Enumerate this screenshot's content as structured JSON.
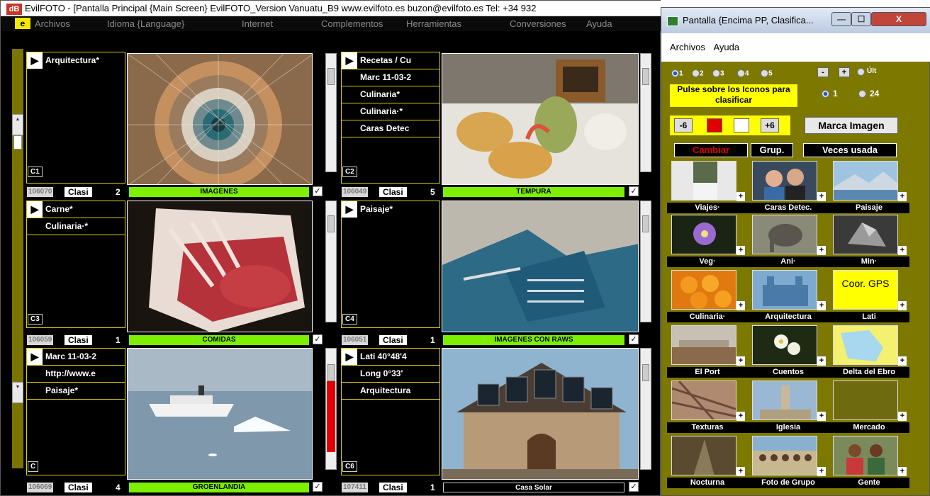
{
  "main": {
    "title": "EvilFOTO - [Pantalla Principal  {Main Screen} EvilFOTO_Version Vanuatu_B9   www.evilfoto.es   buzon@evilfoto.es   Tel: +34 932",
    "app_icon": "dB",
    "menu_icon": "e",
    "menu": [
      "Archivos",
      "Idioma {Language}",
      "Internet",
      "Complementos",
      "Herramientas",
      "Conversiones",
      "Ayuda"
    ]
  },
  "cells": [
    {
      "code": "C1",
      "tags": [
        "Arquitectura*"
      ],
      "id": "106070",
      "clasi": "Clasi",
      "count": "2",
      "group": "IMAGENES",
      "check": "✓",
      "photo_icon": "spiral-staircase-icon"
    },
    {
      "code": "C2",
      "tags": [
        "Recetas / Cu",
        "Marc 11-03-2",
        "Culinaria*",
        "Culinaria·*",
        "Caras Detec"
      ],
      "id": "106049",
      "clasi": "Clasi",
      "count": "5",
      "group": "TEMPURA",
      "check": "✓",
      "photo_icon": "tempura-food-icon"
    },
    {
      "code": "C3",
      "tags": [
        "Carne*",
        "Culinaria·*"
      ],
      "id": "106059",
      "clasi": "Clasi",
      "count": "1",
      "group": "COMIDAS",
      "check": "✓",
      "photo_icon": "raw-meat-icon"
    },
    {
      "code": "C4",
      "tags": [
        "Paisaje*"
      ],
      "id": "106051",
      "clasi": "Clasi",
      "count": "1",
      "group": "IMAGENES CON RAWS",
      "check": "✓",
      "photo_icon": "harbor-aerial-icon"
    },
    {
      "code": "C",
      "tags": [
        "Marc 11-03-2",
        "http://www.e",
        "Paisaje*"
      ],
      "id": "106069",
      "clasi": "Clasi",
      "count": "4",
      "group": "GROENLANDIA",
      "check": "✓",
      "photo_icon": "cruise-ship-icon"
    },
    {
      "code": "C6",
      "tags": [
        "Lati  40°48'4",
        "Long   0°33'",
        "Arquitectura"
      ],
      "id": "107411",
      "clasi": "Clasi",
      "count": "1",
      "group": "Casa Solar",
      "check": "✓",
      "photo_icon": "solar-house-icon"
    }
  ],
  "right": {
    "title": "Pantalla {Encima PP, Clasifica...",
    "window_buttons": [
      "—",
      "☐",
      "X"
    ],
    "menu": [
      "Archivos",
      "Ayuda"
    ],
    "radios": [
      "1",
      "2",
      "3",
      "4",
      "5"
    ],
    "minus": "-",
    "plus": "+",
    "ult": "Últ",
    "note": "Pulse sobre los Iconos para clasificar",
    "radio_1": "1",
    "radio_24": "24",
    "minus6": "-6",
    "plus6": "+6",
    "marca": "Marca Imagen",
    "cambiar": "Cambiar",
    "grup": "Grup.",
    "veces": "Veces usada",
    "gps_text": "Coor. GPS",
    "icons": [
      {
        "label": "Viajes·",
        "icon": "snow-wall-icon"
      },
      {
        "label": "Caras Detec.",
        "icon": "couple-portrait-icon"
      },
      {
        "label": "Paisaje",
        "icon": "mountain-lake-icon"
      },
      {
        "label": "Veg·",
        "icon": "purple-flower-icon"
      },
      {
        "label": "Ani·",
        "icon": "elephant-icon"
      },
      {
        "label": "Min·",
        "icon": "mineral-icon"
      },
      {
        "label": "Culinaria·",
        "icon": "oranges-icon"
      },
      {
        "label": "Arquitectura",
        "icon": "castle-icon"
      },
      {
        "label": "Lati",
        "icon": "gps-coordinates-icon"
      },
      {
        "label": "El Port",
        "icon": "port-icon"
      },
      {
        "label": "Cuentos",
        "icon": "white-flowers-icon"
      },
      {
        "label": "Delta del Ebro",
        "icon": "map-icon"
      },
      {
        "label": "Texturas",
        "icon": "texture-icon"
      },
      {
        "label": "Iglesia",
        "icon": "church-tower-icon"
      },
      {
        "label": "Mercado",
        "icon": "market-icon"
      },
      {
        "label": "Nocturna",
        "icon": "night-icon"
      },
      {
        "label": "Foto de Grupo",
        "icon": "group-photo-icon"
      },
      {
        "label": "Gente",
        "icon": "people-icon"
      }
    ]
  }
}
